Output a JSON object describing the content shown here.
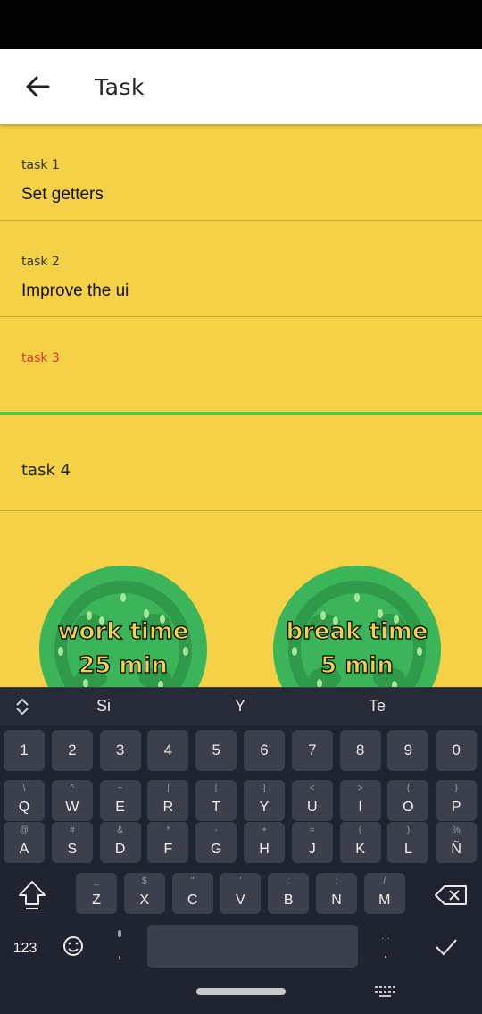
{
  "app_bar": {
    "title": "Task"
  },
  "tasks": [
    {
      "label": "task 1",
      "value": "Set getters"
    },
    {
      "label": "task 2",
      "value": "Improve the ui"
    },
    {
      "label": "task 3",
      "value": ""
    },
    {
      "label": "",
      "value": "task 4"
    }
  ],
  "timers": {
    "work": {
      "line1": "work time",
      "line2": "25 min"
    },
    "break": {
      "line1": "break time",
      "line2": "5 min"
    }
  },
  "keyboard": {
    "suggestions": [
      "Si",
      "Y",
      "Te"
    ],
    "number_row": [
      "1",
      "2",
      "3",
      "4",
      "5",
      "6",
      "7",
      "8",
      "9",
      "0"
    ],
    "row1": [
      [
        "Q",
        "\\"
      ],
      [
        "W",
        "^"
      ],
      [
        "E",
        "~"
      ],
      [
        "R",
        "|"
      ],
      [
        "T",
        "["
      ],
      [
        "Y",
        "]"
      ],
      [
        "U",
        "<"
      ],
      [
        "I",
        ">"
      ],
      [
        "O",
        "{"
      ],
      [
        "P",
        "}"
      ]
    ],
    "row2": [
      [
        "A",
        "@"
      ],
      [
        "S",
        "#"
      ],
      [
        "D",
        "&"
      ],
      [
        "F",
        "*"
      ],
      [
        "G",
        "-"
      ],
      [
        "H",
        "+"
      ],
      [
        "J",
        "="
      ],
      [
        "K",
        "("
      ],
      [
        "L",
        ")"
      ],
      [
        "Ñ",
        "%"
      ]
    ],
    "row3": [
      [
        "Z",
        "_"
      ],
      [
        "X",
        "$"
      ],
      [
        "C",
        "\""
      ],
      [
        "V",
        "'"
      ],
      [
        "B",
        ":"
      ],
      [
        "N",
        ";"
      ],
      [
        "M",
        "/"
      ]
    ],
    "mode_label": "123",
    "comma_label": ",",
    "period_label": "."
  },
  "colors": {
    "background": "#f4d146",
    "tomato": "#3cb55a",
    "focus_underline": "#3ccf4e",
    "focus_label": "#d93a2b"
  }
}
